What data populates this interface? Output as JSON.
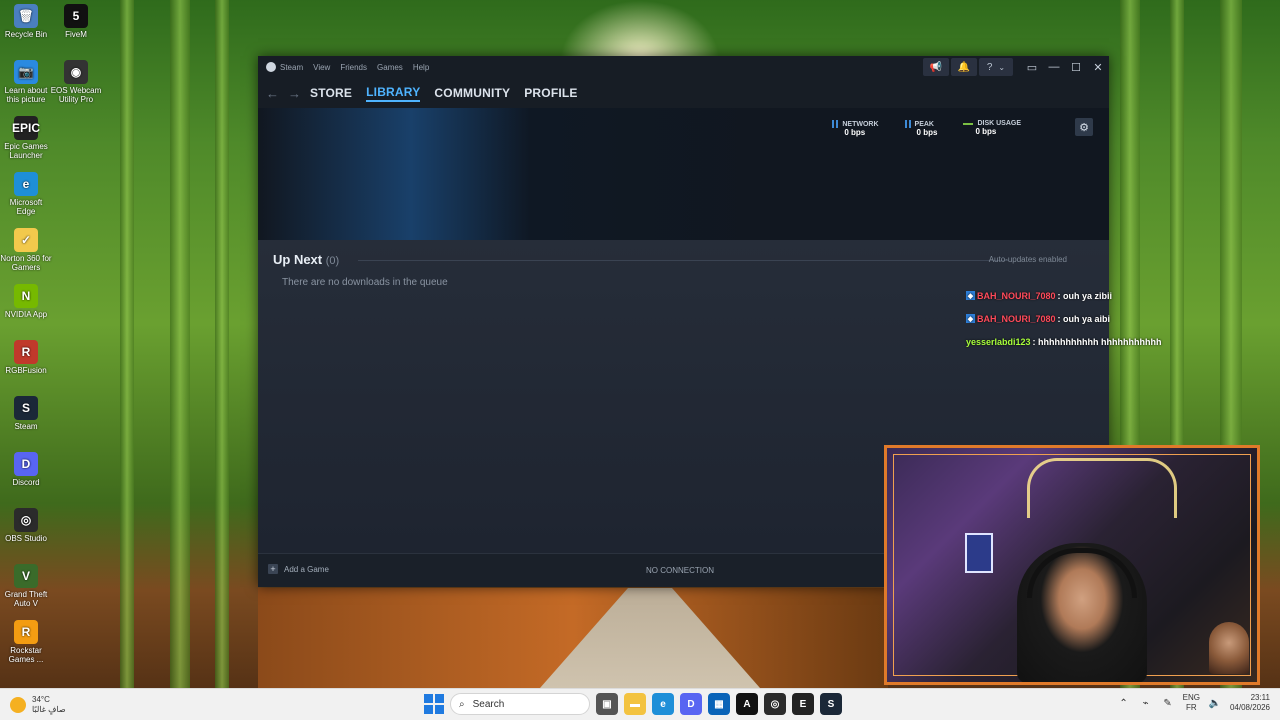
{
  "desktop": {
    "icons": [
      {
        "label": "Recycle Bin",
        "glyph": "🗑",
        "color": "#4a7fc0"
      },
      {
        "label": "FiveM",
        "glyph": "5",
        "color": "#111111"
      },
      {
        "label": "Learn about this picture",
        "glyph": "📷",
        "color": "#2a8ae0"
      },
      {
        "label": "EOS Webcam Utility Pro",
        "glyph": "◉",
        "color": "#333333"
      },
      {
        "label": "Epic Games Launcher",
        "glyph": "EPIC",
        "color": "#222222"
      },
      {
        "label": "Microsoft Edge",
        "glyph": "e",
        "color": "#1e8fd8"
      },
      {
        "label": "Norton 360 for Gamers",
        "glyph": "✓",
        "color": "#f2c94c"
      },
      {
        "label": "NVIDIA App",
        "glyph": "N",
        "color": "#76b900"
      },
      {
        "label": "RGBFusion",
        "glyph": "R",
        "color": "#c0392b"
      },
      {
        "label": "Steam",
        "glyph": "S",
        "color": "#1b2838"
      },
      {
        "label": "Discord",
        "glyph": "D",
        "color": "#5865f2"
      },
      {
        "label": "OBS Studio",
        "glyph": "◎",
        "color": "#2b2b2b"
      },
      {
        "label": "Grand Theft Auto V",
        "glyph": "V",
        "color": "#3a6b2a"
      },
      {
        "label": "Rockstar Games ...",
        "glyph": "R",
        "color": "#f39c12"
      }
    ]
  },
  "steam": {
    "app_name": "Steam",
    "menu": [
      "View",
      "Friends",
      "Games",
      "Help"
    ],
    "title_buttons": {
      "announce": "📢",
      "notify": "🔔",
      "help": "?",
      "chevron": "⌄"
    },
    "window_controls": {
      "mini": "▭",
      "minimize": "—",
      "maximize": "☐",
      "close": "✕"
    },
    "nav": {
      "back": "←",
      "forward": "→",
      "items": [
        "STORE",
        "LIBRARY",
        "COMMUNITY",
        "PROFILE"
      ],
      "active": "LIBRARY"
    },
    "stats": [
      {
        "label": "NETWORK",
        "value": "0 bps",
        "icon": "bars-icon"
      },
      {
        "label": "PEAK",
        "value": "0 bps",
        "icon": "bars-icon"
      },
      {
        "label": "DISK USAGE",
        "value": "0 bps",
        "icon": "line-icon"
      }
    ],
    "settings_glyph": "⚙",
    "queue": {
      "title": "Up Next",
      "count": "(0)",
      "auto_updates": "Auto-updates enabled",
      "empty_message": "There are no downloads in the queue"
    },
    "footer": {
      "add_game": "Add a Game",
      "add_glyph": "+",
      "status": "NO CONNECTION"
    }
  },
  "chat": {
    "messages": [
      {
        "user": "BAH_NOURI_7080",
        "message": ": ouh ya zibii",
        "color": "red",
        "badge": true
      },
      {
        "user": "BAH_NOURI_7080",
        "message": ": ouh ya aibi",
        "color": "red",
        "badge": true
      },
      {
        "user": "yesserlabdi123",
        "message": ": hhhhhhhhhhh hhhhhhhhhhh",
        "color": "green",
        "badge": false
      }
    ]
  },
  "taskbar": {
    "weather": {
      "temp": "34°C",
      "desc": "صافٍ غالبًا"
    },
    "search_placeholder": "Search",
    "language": {
      "lang": "ENG",
      "layout": "FR"
    },
    "clock": {
      "time": "23:11",
      "date": "04/08/2026"
    },
    "tray_icons": {
      "chevron": "⌃",
      "network": "⌁",
      "volume": "🔈",
      "pen": "✎"
    }
  },
  "colors": {
    "accent": "#4fb4ff",
    "cam_border": "#e07a2a"
  }
}
